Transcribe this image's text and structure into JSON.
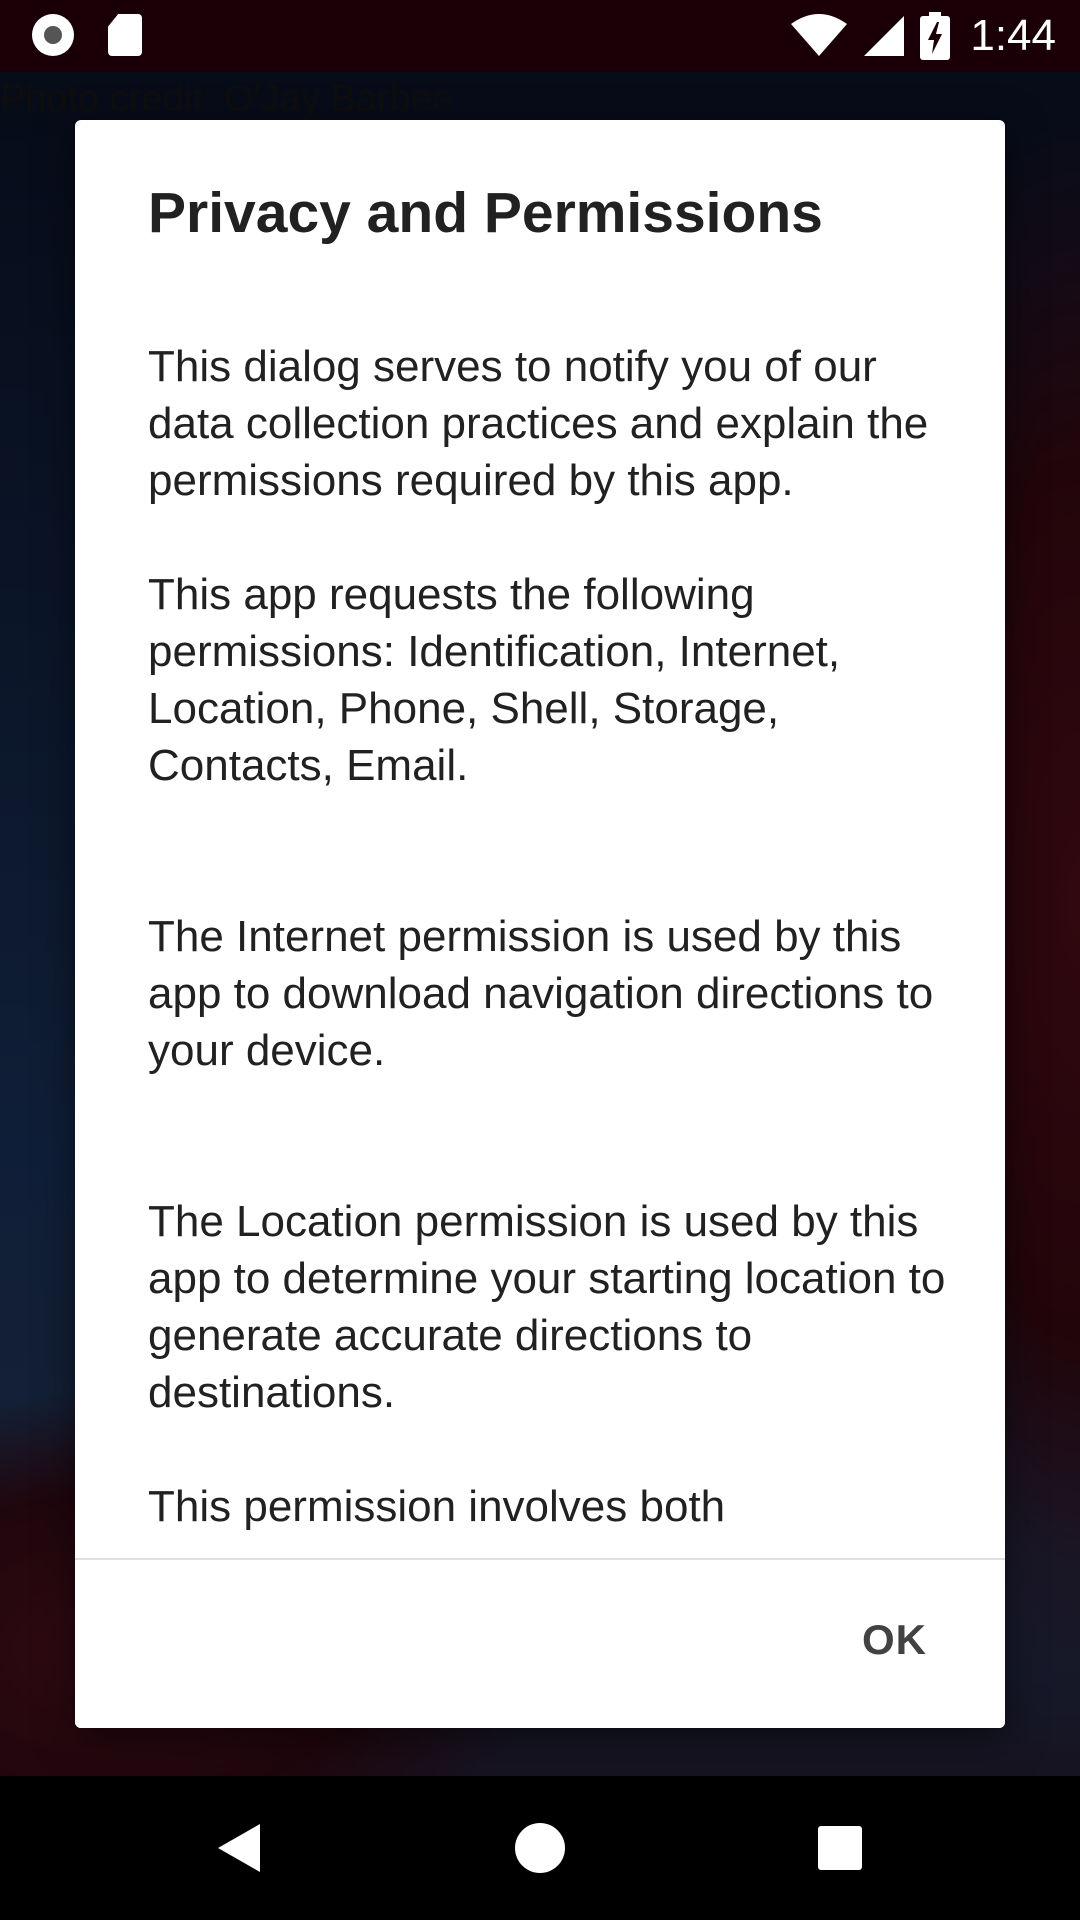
{
  "status_bar": {
    "time": "1:44",
    "left_icons": [
      "screen-record-icon",
      "sd-card-icon"
    ],
    "right_icons": [
      "wifi-icon",
      "cell-signal-icon",
      "battery-charging-icon"
    ]
  },
  "background": {
    "photo_credit": "Photo credit: O'Jay Barbee"
  },
  "dialog": {
    "title": "Privacy and Permissions",
    "paragraphs": [
      "This dialog serves to notify you of our data collection practices and explain the permissions required by this app.",
      "This app requests the following permissions: Identification, Internet, Location, Phone, Shell, Storage, Contacts, Email.",
      "The Internet permission is used by this app to download navigation directions to your device.",
      "The Location permission is used by this app to determine your starting location to generate accurate directions to destinations.",
      "This permission involves both"
    ],
    "ok_label": "OK"
  },
  "nav_bar": {
    "icons": [
      "back-icon",
      "home-icon",
      "recents-icon"
    ]
  }
}
